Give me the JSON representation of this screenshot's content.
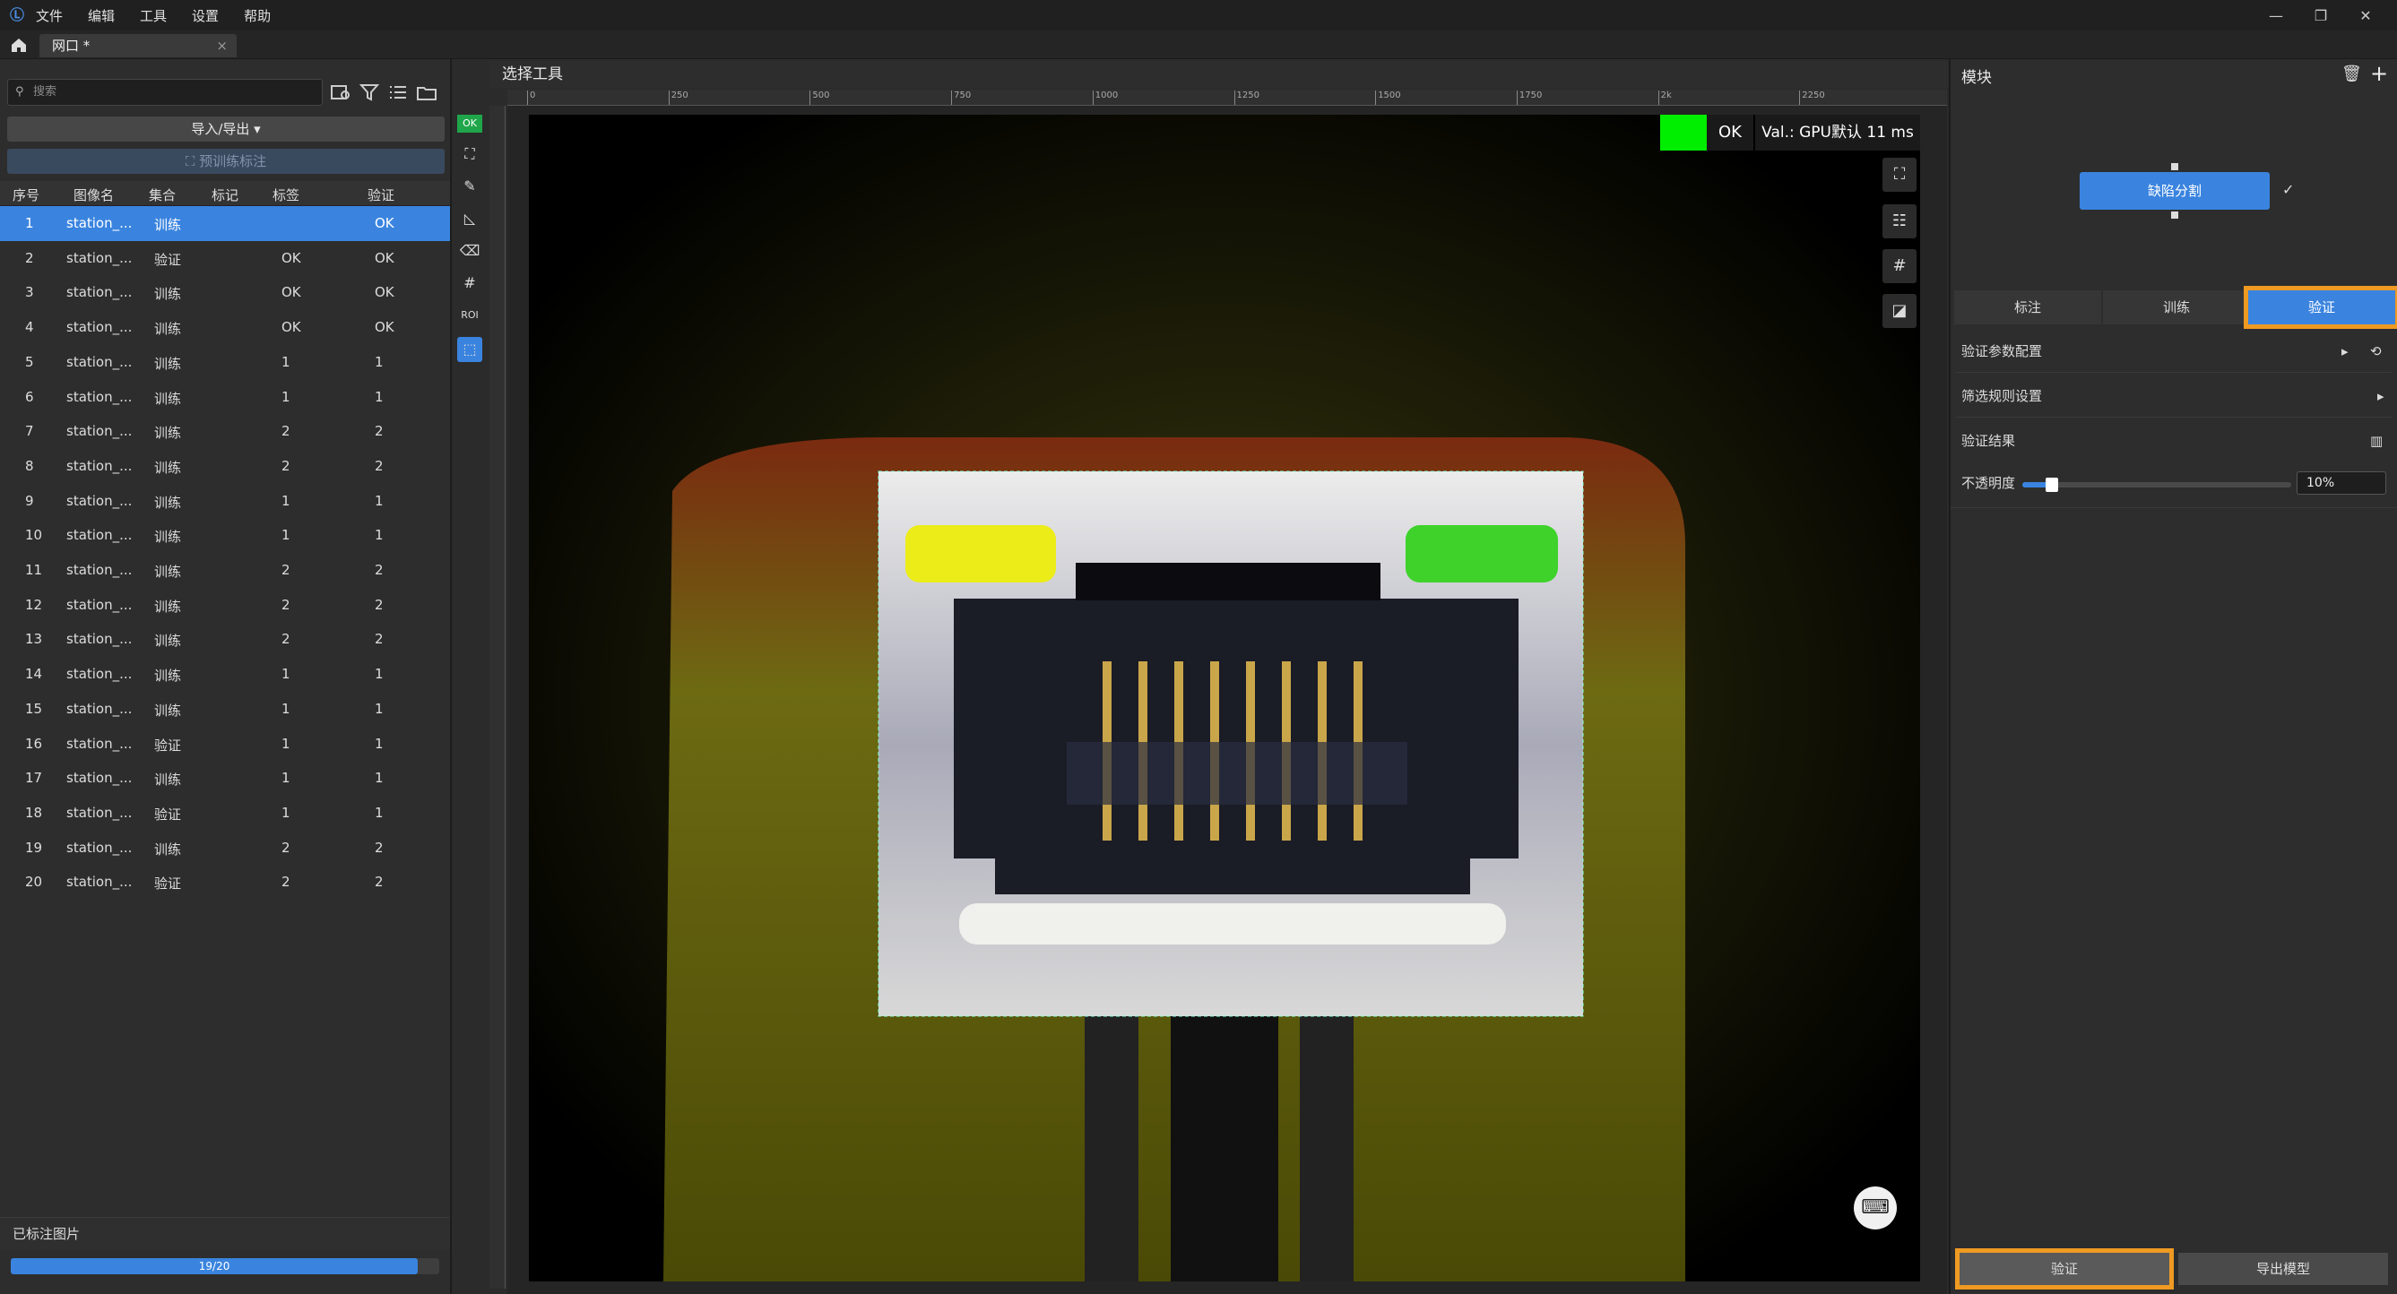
{
  "titlebar": {
    "menu": [
      "文件",
      "编辑",
      "工具",
      "设置",
      "帮助"
    ],
    "minimize": "—",
    "restore": "❐",
    "close": "✕"
  },
  "tabbar": {
    "tab_label": "网口 *",
    "close": "×"
  },
  "left": {
    "search_placeholder": "搜索",
    "import_export": "导入/导出 ▾",
    "pretrain_label": "⛶ 预训练标注",
    "columns": [
      "序号",
      "图像名",
      "集合",
      "标记",
      "标签",
      "验证"
    ],
    "rows": [
      {
        "idx": "1",
        "name": "station_...",
        "set": "训练",
        "mark": "",
        "label": "",
        "verify": "OK"
      },
      {
        "idx": "2",
        "name": "station_...",
        "set": "验证",
        "mark": "",
        "label": "OK",
        "verify": "OK"
      },
      {
        "idx": "3",
        "name": "station_...",
        "set": "训练",
        "mark": "",
        "label": "OK",
        "verify": "OK"
      },
      {
        "idx": "4",
        "name": "station_...",
        "set": "训练",
        "mark": "",
        "label": "OK",
        "verify": "OK"
      },
      {
        "idx": "5",
        "name": "station_...",
        "set": "训练",
        "mark": "",
        "label": "1",
        "verify": "1"
      },
      {
        "idx": "6",
        "name": "station_...",
        "set": "训练",
        "mark": "",
        "label": "1",
        "verify": "1"
      },
      {
        "idx": "7",
        "name": "station_...",
        "set": "训练",
        "mark": "",
        "label": "2",
        "verify": "2"
      },
      {
        "idx": "8",
        "name": "station_...",
        "set": "训练",
        "mark": "",
        "label": "2",
        "verify": "2"
      },
      {
        "idx": "9",
        "name": "station_...",
        "set": "训练",
        "mark": "",
        "label": "1",
        "verify": "1"
      },
      {
        "idx": "10",
        "name": "station_...",
        "set": "训练",
        "mark": "",
        "label": "1",
        "verify": "1"
      },
      {
        "idx": "11",
        "name": "station_...",
        "set": "训练",
        "mark": "",
        "label": "2",
        "verify": "2"
      },
      {
        "idx": "12",
        "name": "station_...",
        "set": "训练",
        "mark": "",
        "label": "2",
        "verify": "2"
      },
      {
        "idx": "13",
        "name": "station_...",
        "set": "训练",
        "mark": "",
        "label": "2",
        "verify": "2"
      },
      {
        "idx": "14",
        "name": "station_...",
        "set": "训练",
        "mark": "",
        "label": "1",
        "verify": "1"
      },
      {
        "idx": "15",
        "name": "station_...",
        "set": "训练",
        "mark": "",
        "label": "1",
        "verify": "1"
      },
      {
        "idx": "16",
        "name": "station_...",
        "set": "验证",
        "mark": "",
        "label": "1",
        "verify": "1"
      },
      {
        "idx": "17",
        "name": "station_...",
        "set": "训练",
        "mark": "",
        "label": "1",
        "verify": "1"
      },
      {
        "idx": "18",
        "name": "station_...",
        "set": "验证",
        "mark": "",
        "label": "1",
        "verify": "1"
      },
      {
        "idx": "19",
        "name": "station_...",
        "set": "训练",
        "mark": "",
        "label": "2",
        "verify": "2"
      },
      {
        "idx": "20",
        "name": "station_...",
        "set": "验证",
        "mark": "",
        "label": "2",
        "verify": "2"
      }
    ],
    "footer_label": "已标注图片",
    "progress_text": "19/20",
    "progress_fraction": 0.95
  },
  "center": {
    "title": "选择工具",
    "ruler_ticks": [
      "0",
      "250",
      "500",
      "750",
      "1000",
      "1250",
      "1500",
      "1750",
      "2k",
      "2250"
    ],
    "status_ok": "OK",
    "status_val": "Val.: GPU默认 11 ms",
    "vtool_ok": "OK",
    "vtool_roi": "ROI"
  },
  "right": {
    "title": "模块",
    "module": "缺陷分割",
    "tabs": [
      "标注",
      "训练",
      "验证"
    ],
    "rows": [
      "验证参数配置",
      "筛选规则设置",
      "验证结果"
    ],
    "opacity_label": "不透明度",
    "opacity_value": "10%",
    "opacity_fraction": 0.1,
    "btn_verify": "验证",
    "btn_export": "导出模型"
  },
  "colors": {
    "accent": "#3a84df",
    "highlight": "#ef9a22",
    "ok_green": "#00ee00"
  }
}
